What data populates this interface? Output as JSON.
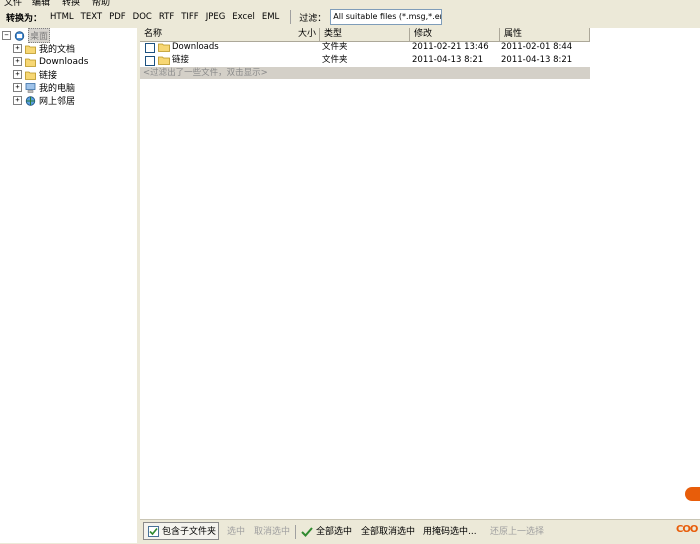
{
  "menu": {
    "items": [
      "文件",
      "编辑",
      "转换",
      "帮助"
    ]
  },
  "toolbar": {
    "convert_label": "转换为：",
    "formats": [
      "HTML",
      "TEXT",
      "PDF",
      "DOC",
      "RTF",
      "TIFF",
      "JPEG",
      "Excel",
      "EML"
    ],
    "filter_label": "过滤：",
    "filter_value": "All suitable files (*.msg,*.eml)"
  },
  "tree": {
    "items": [
      {
        "label": "桌面",
        "icon": "desktop-icon",
        "selected": true
      },
      {
        "label": "我的文档",
        "icon": "folder-icon"
      },
      {
        "label": "Downloads",
        "icon": "folder-icon"
      },
      {
        "label": "链接",
        "icon": "folder-icon"
      },
      {
        "label": "我的电脑",
        "icon": "computer-icon"
      },
      {
        "label": "网上邻居",
        "icon": "network-icon"
      }
    ]
  },
  "list": {
    "columns": [
      "名称",
      "大小",
      "类型",
      "修改",
      "属性"
    ],
    "rows": [
      {
        "name": "Downloads",
        "size": "",
        "type": "文件夹",
        "modified": "2011-02-21 13:46",
        "attr": "2011-02-01 8:44"
      },
      {
        "name": "链接",
        "size": "",
        "type": "文件夹",
        "modified": "2011-04-13 8:21",
        "attr": "2011-04-13 8:21"
      }
    ],
    "hint": "<过滤出了一些文件，双击显示>"
  },
  "bottombar": {
    "include_subfolders": "包含子文件夹",
    "select": "选中",
    "deselect": "取消选中",
    "select_all": "全部选中",
    "deselect_all": "全部取消选中",
    "select_by_mask": "用掩码选中...",
    "restore_last": "还原上一选择",
    "brand": "COO"
  },
  "colors": {
    "accent": "#e85d0a",
    "panel": "#ece9d8"
  }
}
